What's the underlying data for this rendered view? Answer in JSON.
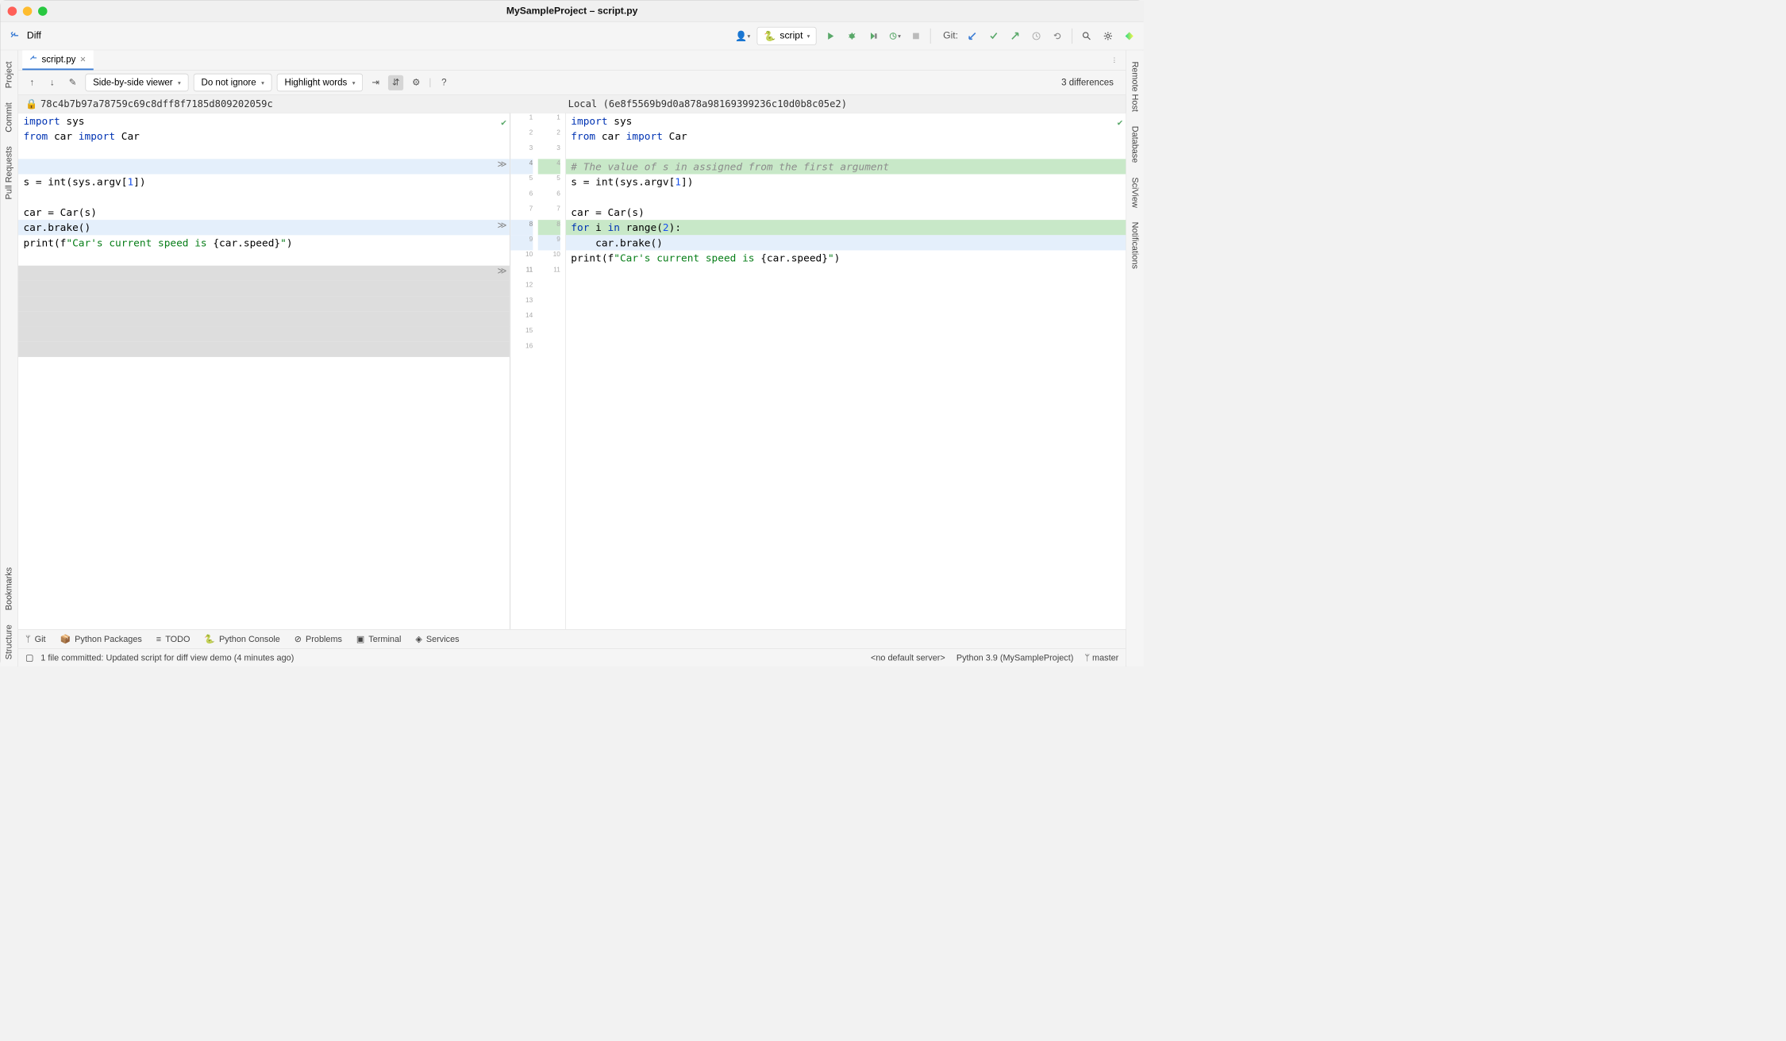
{
  "window": {
    "title": "MySampleProject – script.py"
  },
  "toolbar": {
    "diff": "Diff",
    "runConfig": "script",
    "git": "Git:"
  },
  "leftSidebar": [
    "Project",
    "Commit",
    "Pull Requests",
    "Bookmarks",
    "Structure"
  ],
  "rightSidebar": [
    "Remote Host",
    "Database",
    "SciView",
    "Notifications"
  ],
  "fileTab": {
    "name": "script.py"
  },
  "diffToolbar": {
    "viewer": "Side-by-side viewer",
    "ignore": "Do not ignore",
    "highlight": "Highlight words",
    "count": "3 differences"
  },
  "hashes": {
    "left": "78c4b7b97a78759c69c8dff8f7185d809202059c",
    "right": "Local (6e8f5569b9d0a878a98169399236c10d0b8c05e2)"
  },
  "leftCode": {
    "l1a": "import ",
    "l1b": "sys",
    "l2a": "from ",
    "l2b": "car ",
    "l2c": "import ",
    "l2d": "Car",
    "l5a": "s = int(sys.argv[",
    "l5b": "1",
    "l5c": "])",
    "l7": "car = Car(s)",
    "l8": "car.brake()",
    "l9a": "print(f",
    "l9b": "\"Car's current speed is ",
    "l9c": "{car.speed}",
    "l9d": "\"",
    "l9e": ")"
  },
  "rightCode": {
    "l1a": "import ",
    "l1b": "sys",
    "l2a": "from ",
    "l2b": "car ",
    "l2c": "import ",
    "l2d": "Car",
    "l4": "# The value of s in assigned from the first argument",
    "l5a": "s = int(sys.argv[",
    "l5b": "1",
    "l5c": "])",
    "l7": "car = Car(s)",
    "l8a": "for ",
    "l8b": "i ",
    "l8c": "in ",
    "l8d": "range(",
    "l8e": "2",
    "l8f": "):",
    "l9": "    car.brake()",
    "l10a": "print(f",
    "l10b": "\"Car's current speed is ",
    "l10c": "{car.speed}",
    "l10d": "\"",
    "l10e": ")"
  },
  "gutterLeft": [
    "1",
    "2",
    "3",
    "4",
    "5",
    "6",
    "7",
    "8",
    "9",
    "10",
    "11",
    "12",
    "13",
    "14",
    "15",
    "16"
  ],
  "gutterRight": [
    "1",
    "2",
    "3",
    "4",
    "5",
    "6",
    "7",
    "8",
    "9",
    "10",
    "11"
  ],
  "bottomTabs": [
    "Git",
    "Python Packages",
    "TODO",
    "Python Console",
    "Problems",
    "Terminal",
    "Services"
  ],
  "status": {
    "msg": "1 file committed: Updated script for diff view demo (4 minutes ago)",
    "server": "<no default server>",
    "python": "Python 3.9 (MySampleProject)",
    "branch": "master"
  }
}
